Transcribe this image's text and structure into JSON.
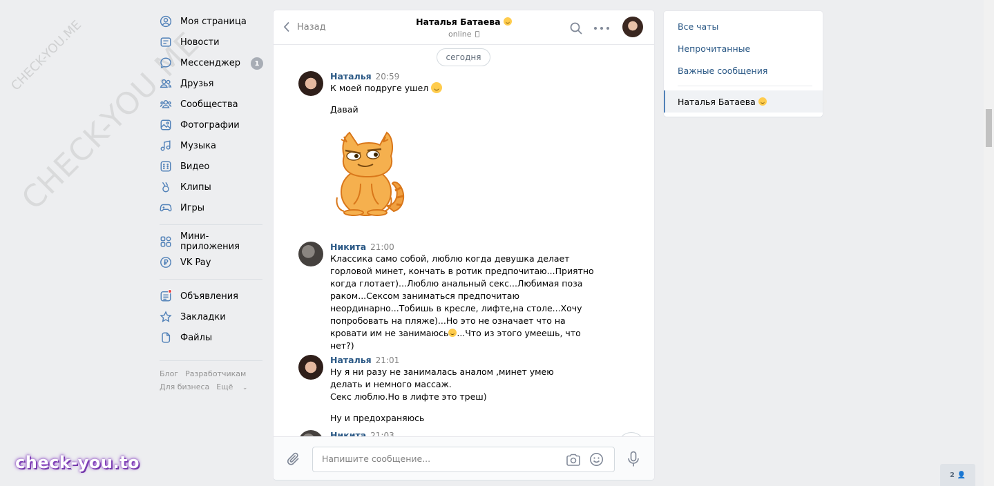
{
  "watermarks": {
    "large": "CHECK-YOU.ME",
    "small": "CHECK-YOU.ME",
    "brand": "check-you.to"
  },
  "nav": {
    "items": [
      {
        "label": "Моя страница",
        "icon": "user-circle-icon"
      },
      {
        "label": "Новости",
        "icon": "news-icon"
      },
      {
        "label": "Мессенджер",
        "icon": "chat-bubble-icon",
        "badge": "1"
      },
      {
        "label": "Друзья",
        "icon": "friends-icon"
      },
      {
        "label": "Сообщества",
        "icon": "communities-icon"
      },
      {
        "label": "Фотографии",
        "icon": "photo-icon"
      },
      {
        "label": "Музыка",
        "icon": "music-icon"
      },
      {
        "label": "Видео",
        "icon": "video-icon"
      },
      {
        "label": "Клипы",
        "icon": "clips-icon"
      },
      {
        "label": "Игры",
        "icon": "gamepad-icon"
      }
    ],
    "items2": [
      {
        "label": "Мини-приложения",
        "icon": "apps-grid-icon"
      },
      {
        "label": "VK Pay",
        "icon": "ruble-icon"
      }
    ],
    "items3": [
      {
        "label": "Объявления",
        "icon": "ads-icon"
      },
      {
        "label": "Закладки",
        "icon": "star-icon"
      },
      {
        "label": "Файлы",
        "icon": "file-icon"
      }
    ],
    "footer": {
      "blog": "Блог",
      "developers": "Разработчикам",
      "business": "Для бизнеса",
      "more": "Ещё"
    }
  },
  "chat": {
    "back_label": "Назад",
    "peer_name": "Наталья Батаева",
    "peer_status": "online",
    "date_label": "сегодня",
    "input_placeholder": "Напишите сообщение...",
    "messages": [
      {
        "author": "Наталья",
        "time": "20:59",
        "lines": [
          "К моей подруге ушел",
          "Давай"
        ]
      },
      {
        "author": "Никита",
        "time": "21:00",
        "text": "Классика само собой, люблю когда девушка делает горловой минет, кончать в ротик предпочитаю...Приятно когда глотает)...Люблю анальный секс...Любимая поза раком...Сексом заниматься предпочитаю неординарно...Тобишь в кресле, лифте,на столе...Хочу попробовать на пляже)...Но это не означает что на кровати им не занимаюсь",
        "text_tail": "...Что из этого умеешь, что нет?)"
      },
      {
        "author": "Наталья",
        "time": "21:01",
        "lines": [
          "Ну я ни разу не занималась аналом ,минет умею делать и немного массаж.",
          "Секс люблю.Но в лифте это треш)",
          "Ну и предохраняюсь"
        ]
      },
      {
        "author": "Никита",
        "time": "21:03"
      }
    ]
  },
  "right": {
    "all_chats": "Все чаты",
    "unread": "Непрочитанные",
    "important": "Важные сообщения",
    "active_chat": "Наталья Батаева"
  },
  "footer_badge": {
    "count": "2"
  },
  "colors": {
    "accent": "#5181b8",
    "link": "#2a5885",
    "background": "#edeef0"
  }
}
